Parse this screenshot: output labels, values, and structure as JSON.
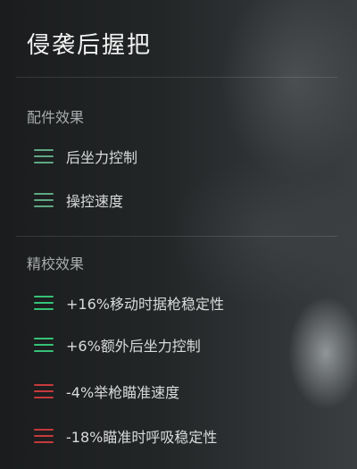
{
  "title": "侵袭后握把",
  "attachment_effects": {
    "label": "配件效果",
    "items": [
      {
        "text": "后坐力控制",
        "polarity": "positive"
      },
      {
        "text": "操控速度",
        "polarity": "positive"
      }
    ]
  },
  "tuning_effects": {
    "label": "精校效果",
    "items": [
      {
        "text": "+16%移动时据枪稳定性",
        "polarity": "positive"
      },
      {
        "text": "+6%额外后坐力控制",
        "polarity": "positive"
      },
      {
        "text": "-4%举枪瞄准速度",
        "polarity": "negative"
      },
      {
        "text": "-18%瞄准时呼吸稳定性",
        "polarity": "negative"
      }
    ]
  },
  "colors": {
    "positive": "#36c277",
    "negative": "#c63a3c"
  }
}
